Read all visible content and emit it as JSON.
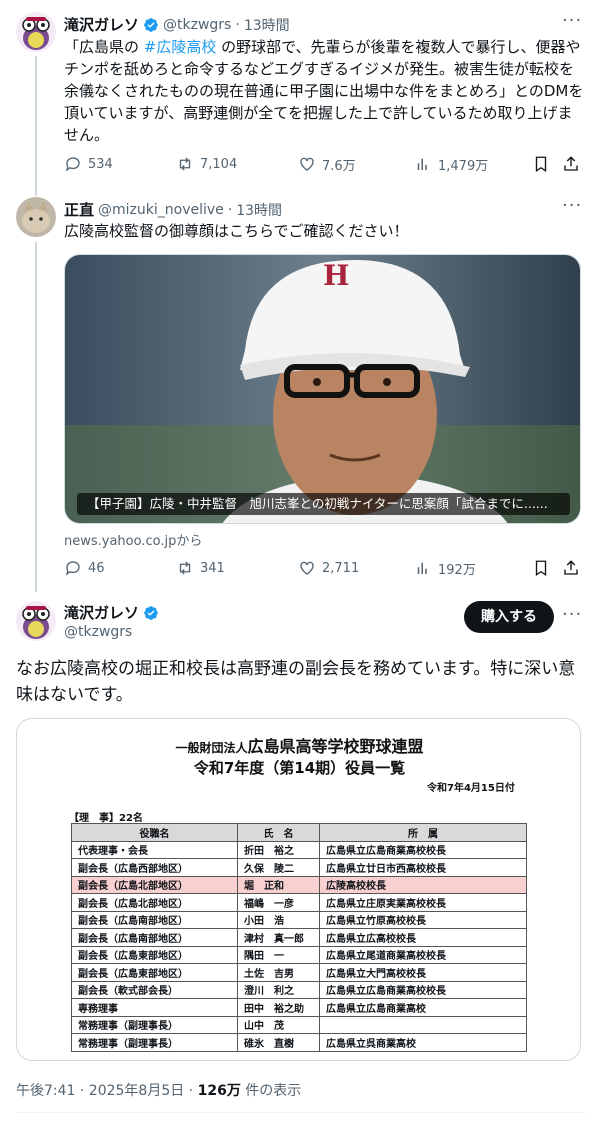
{
  "tweet1": {
    "name": "滝沢ガレソ",
    "handle": "@tkzwgrs",
    "time": "13時間",
    "text_pre": "「広島県の ",
    "hashtag": "#広陵高校",
    "text_post": " の野球部で、先輩らが後輩を複数人で暴行し、便器やチンポを舐めろと命令するなどエグすぎるイジメが発生。被害生徒が転校を余儀なくされたものの現在普通に甲子園に出場中な件をまとめろ」とのDMを頂いていますが、高野連側が全てを把握した上で許しているため取り上げません。",
    "replies": "534",
    "reposts": "7,104",
    "likes": "7.6万",
    "views": "1,479万"
  },
  "tweet2": {
    "name": "正直",
    "handle": "@mizuki_novelive",
    "time": "13時間",
    "text": "広陵高校監督の御尊顔はこちらでご確認ください！",
    "card_caption": "【甲子園】広陵・中井監督　旭川志峯との初戦ナイターに思案顔「試合までに......",
    "card_source": "news.yahoo.co.jpから",
    "replies": "46",
    "reposts": "341",
    "likes": "2,711",
    "views": "192万"
  },
  "tweet3": {
    "name": "滝沢ガレソ",
    "handle": "@tkzwgrs",
    "buy_button": "購入する",
    "text": "なお広陵高校の堀正和校長は高野連の副会長を務めています。特に深い意味はないです。",
    "doc": {
      "org_prefix": "一般財団法人",
      "org_name": "広島県高等学校野球連盟",
      "title": "令和7年度（第14期）役員一覧",
      "date": "令和7年4月15日付",
      "section": "【理　事】22名",
      "headers": [
        "役職名",
        "氏　名",
        "所　属"
      ],
      "rows": [
        [
          "代表理事・会長",
          "折田　裕之",
          "広島県立広島商業高校校長"
        ],
        [
          "副会長（広島西部地区）",
          "久保　陵二",
          "広島県立廿日市西高校校長"
        ],
        [
          "副会長（広島北部地区）",
          "堀　正和",
          "広陵高校校長"
        ],
        [
          "副会長（広島北部地区）",
          "福嶋　一彦",
          "広島県立庄原実業高校校長"
        ],
        [
          "副会長（広島南部地区）",
          "小田　浩",
          "広島県立竹原高校校長"
        ],
        [
          "副会長（広島南部地区）",
          "津村　真一郎",
          "広島県立広高校校長"
        ],
        [
          "副会長（広島東部地区）",
          "隅田　一",
          "広島県立尾道商業高校校長"
        ],
        [
          "副会長（広島東部地区）",
          "土佐　吉男",
          "広島県立大門高校校長"
        ],
        [
          "副会長（軟式部会長）",
          "澄川　利之",
          "広島県立広島商業高校校長"
        ],
        [
          "専務理事",
          "田中　裕之助",
          "広島県立広島商業高校"
        ],
        [
          "常務理事（副理事長）",
          "山中　茂",
          ""
        ],
        [
          "常務理事（副理事長）",
          "碓氷　直樹",
          "広島県立呉商業高校"
        ]
      ]
    },
    "footer_time": "午後7:41 · 2025年8月5日 · ",
    "footer_views": "126万",
    "footer_views_suffix": " 件の表示"
  },
  "colors": {
    "accent": "#1d9bf0",
    "text": "#0f1419",
    "muted": "#536471",
    "button_bg": "#0f1419"
  },
  "icons": [
    "more-icon",
    "reply-icon",
    "repost-icon",
    "like-icon",
    "views-icon",
    "bookmark-icon",
    "share-icon",
    "verified-icon"
  ]
}
